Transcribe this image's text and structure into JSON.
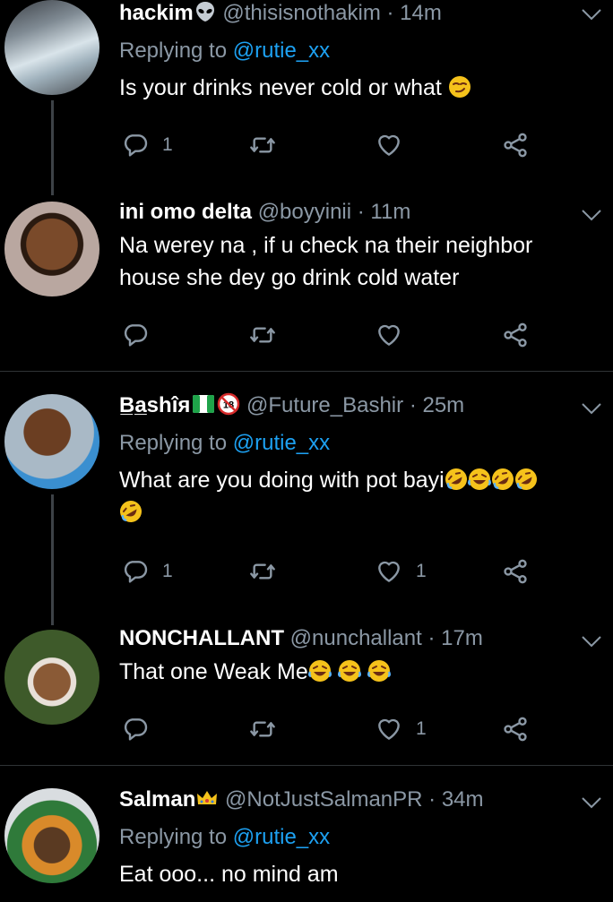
{
  "tweets": [
    {
      "name": "hackim",
      "badge": "alien-emoji",
      "handle": "@thisisnothakim",
      "time": "· 14m",
      "replying_prefix": "Replying to ",
      "replying_to": "@rutie_xx",
      "text": "Is your drinks never cold or  what",
      "text_emoji": "smirk-emoji",
      "replies": "1",
      "retweets": "",
      "likes": ""
    },
    {
      "name": "ini omo delta",
      "handle": "@boyyinii",
      "time": "· 11m",
      "text": "Na werey na , if u check na their neighbor house she dey go drink cold water",
      "replies": "",
      "retweets": "",
      "likes": ""
    },
    {
      "name": "B̲a̲shîя",
      "badge": "nigeria-flag + no-under-18-sign",
      "handle": "@Future_Bashir",
      "time": "· 25m",
      "replying_prefix": "Replying to ",
      "replying_to": "@rutie_xx",
      "text": "What are you doing with pot bayi",
      "text_emoji": "laughing-emojis",
      "replies": "1",
      "retweets": "",
      "likes": "1"
    },
    {
      "name": "NONCHALLANT",
      "handle": "@nunchallant",
      "time": "· 17m",
      "text": "That one Weak Me",
      "text_emoji": "tears-of-joy-emojis",
      "replies": "",
      "retweets": "",
      "likes": "1"
    },
    {
      "name": "Salman",
      "badge": "crown-emoji",
      "handle": "@NotJustSalmanPR",
      "time": "· 34m",
      "replying_prefix": "Replying to ",
      "replying_to": "@rutie_xx",
      "text": "Eat ooo... no mind am"
    }
  ],
  "colors": {
    "background": "#000000",
    "muted": "#8b98a5",
    "link": "#1da1f2",
    "divider": "#2f3336"
  }
}
